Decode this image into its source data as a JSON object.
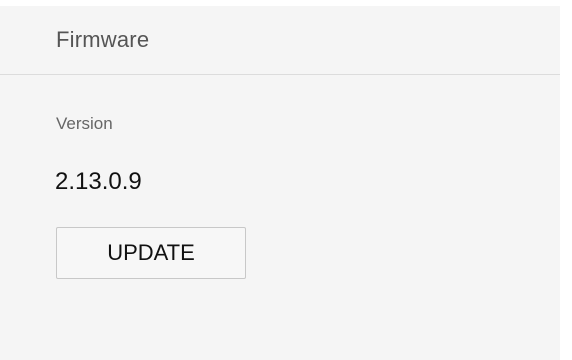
{
  "panel": {
    "title": "Firmware"
  },
  "firmware": {
    "version_label": "Version",
    "version_value": "2.13.0.9",
    "update_button_label": "UPDATE"
  }
}
